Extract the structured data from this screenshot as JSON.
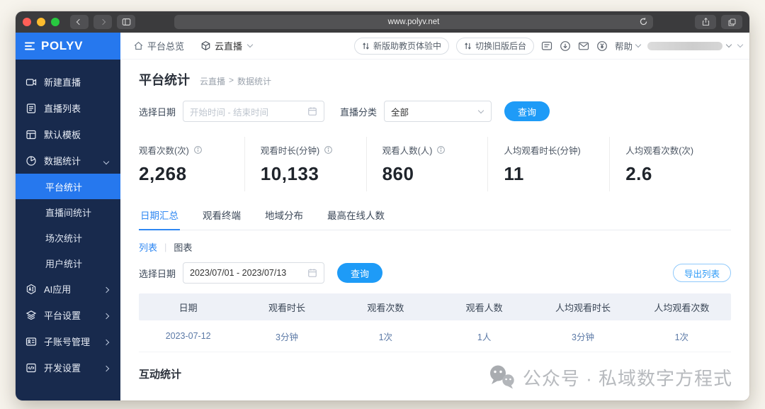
{
  "browser": {
    "url": "www.polyv.net"
  },
  "topbar": {
    "logo": "POLYV",
    "nav_overview": "平台总览",
    "nav_product": "云直播",
    "pill_new_version": "新版助教页体验中",
    "pill_switch_old": "切换旧版后台",
    "help_label": "帮助"
  },
  "sidebar": {
    "items": [
      {
        "label": "新建直播"
      },
      {
        "label": "直播列表"
      },
      {
        "label": "默认模板"
      },
      {
        "label": "数据统计"
      }
    ],
    "submenu": [
      {
        "label": "平台统计",
        "active": true
      },
      {
        "label": "直播间统计"
      },
      {
        "label": "场次统计"
      },
      {
        "label": "用户统计"
      }
    ],
    "items_bottom": [
      {
        "label": "AI应用"
      },
      {
        "label": "平台设置"
      },
      {
        "label": "子账号管理"
      },
      {
        "label": "开发设置"
      }
    ]
  },
  "page": {
    "title": "平台统计",
    "breadcrumb_root": "云直播",
    "breadcrumb_sep": ">",
    "breadcrumb_current": "数据统计",
    "filters": {
      "date_label": "选择日期",
      "date_placeholder": "开始时间 - 结束时间",
      "category_label": "直播分类",
      "category_value": "全部",
      "query_label": "查询"
    },
    "stats": [
      {
        "label": "观看次数(次)",
        "value": "2,268"
      },
      {
        "label": "观看时长(分钟)",
        "value": "10,133"
      },
      {
        "label": "观看人数(人)",
        "value": "860"
      },
      {
        "label": "人均观看时长(分钟)",
        "value": "11"
      },
      {
        "label": "人均观看次数(次)",
        "value": "2.6"
      }
    ],
    "tabs": [
      {
        "label": "日期汇总"
      },
      {
        "label": "观看终端"
      },
      {
        "label": "地域分布"
      },
      {
        "label": "最高在线人数"
      }
    ],
    "view_list_label": "列表",
    "view_sep": "|",
    "view_chart_label": "图表",
    "date_range": {
      "label": "选择日期",
      "value": "2023/07/01 - 2023/07/13",
      "query_label": "查询",
      "export_label": "导出列表"
    },
    "table": {
      "headers": [
        "日期",
        "观看时长",
        "观看次数",
        "观看人数",
        "人均观看时长",
        "人均观看次数"
      ],
      "rows": [
        [
          "2023-07-12",
          "3分钟",
          "1次",
          "1人",
          "3分钟",
          "1次"
        ]
      ]
    },
    "interaction_title": "互动统计",
    "watermark": "公众号 · 私域数字方程式"
  },
  "colors": {
    "accent_button": "#1e9bf7",
    "link_blue": "#2e87f2",
    "sidebar_navy": "#182a4d",
    "logo_blue": "#2678ee",
    "table_header_bg": "#eef1f7"
  }
}
